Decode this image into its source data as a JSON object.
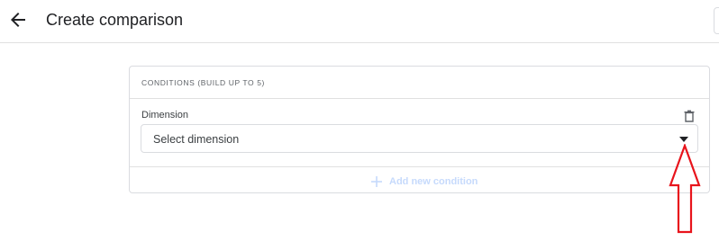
{
  "header": {
    "title": "Create comparison",
    "back_icon": "arrow-back-icon"
  },
  "conditions_card": {
    "title": "CONDITIONS (BUILD UP TO 5)",
    "dimension_label": "Dimension",
    "select_placeholder": "Select dimension",
    "delete_icon": "trash-icon",
    "dropdown_icon": "caret-down-icon",
    "add_condition_label": "Add new condition",
    "add_condition_enabled": false
  },
  "annotation": {
    "type": "red-outline-arrow",
    "points_to": "dropdown-arrow-icon",
    "color": "#e8141c"
  },
  "colors": {
    "text_primary": "#202124",
    "border": "#dadce0",
    "disabled_blue": "#c6dafc",
    "annotation_red": "#e8141c"
  }
}
